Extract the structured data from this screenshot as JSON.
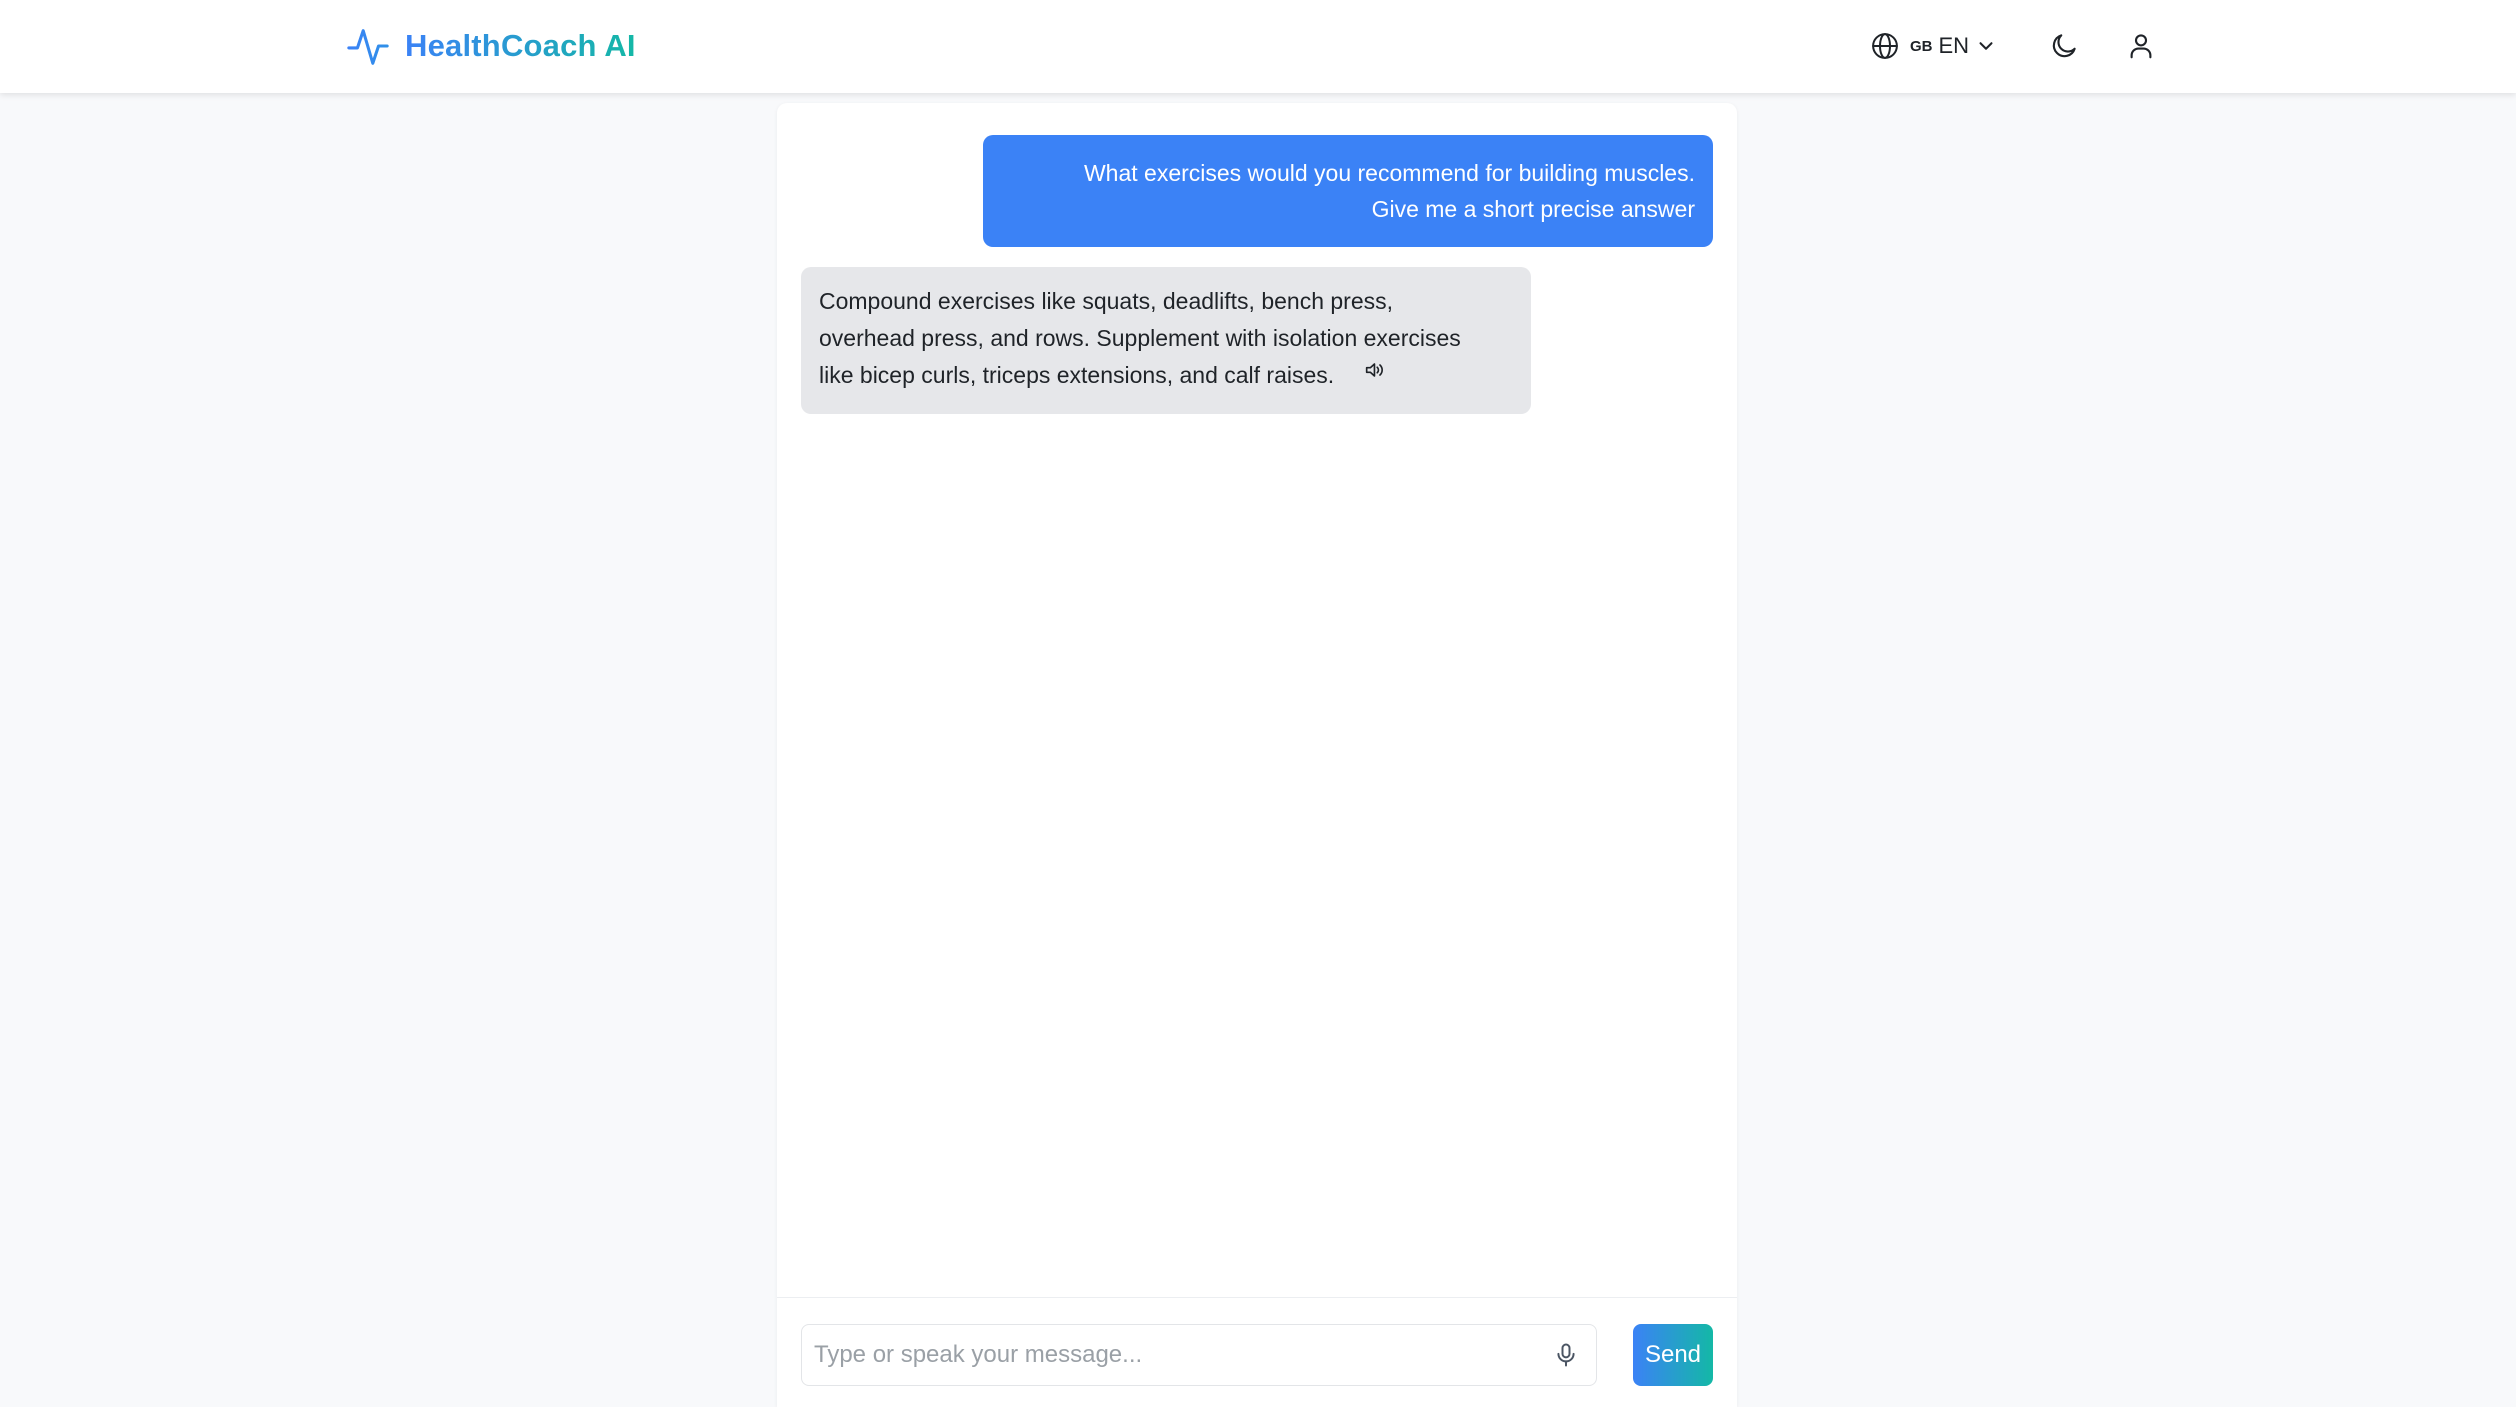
{
  "header": {
    "brand_name": "HealthCoach AI",
    "brand_icon": "activity-pulse-icon",
    "language": {
      "flag": "GB",
      "code": "EN",
      "globe_icon": "globe-icon",
      "chevron_icon": "chevron-down-icon"
    },
    "theme_toggle_icon": "moon-icon",
    "user_icon": "user-icon"
  },
  "chat": {
    "messages": [
      {
        "role": "user",
        "lines": [
          "What exercises would you recommend for building muscles.",
          "Give me a short precise answer"
        ]
      },
      {
        "role": "assistant",
        "lines": [
          "Compound exercises like squats, deadlifts, bench press,",
          "overhead press, and rows. Supplement with isolation exercises",
          "like bicep curls, triceps extensions, and calf raises."
        ],
        "speak_icon": "speaker-icon"
      }
    ]
  },
  "composer": {
    "placeholder": "Type or speak your message...",
    "value": "",
    "mic_icon": "microphone-icon",
    "send_label": "Send"
  },
  "colors": {
    "accent": "#3b82f6",
    "accent_secondary": "#14b8a6",
    "user_bubble": "#3b82f6",
    "bot_bubble": "#e6e7ea",
    "page_background": "#f8f9fb"
  }
}
